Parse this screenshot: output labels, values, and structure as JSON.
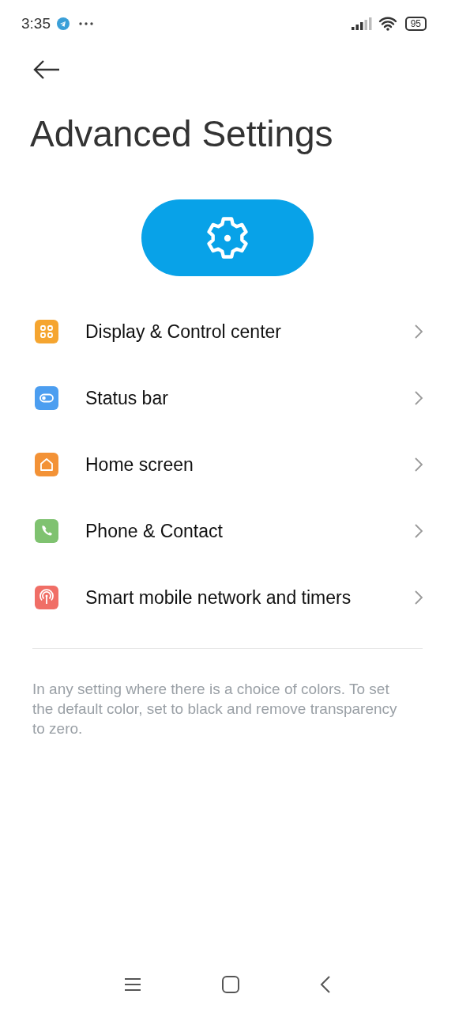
{
  "status_bar": {
    "time": "3:35",
    "battery": "95"
  },
  "title": "Advanced Settings",
  "items": [
    {
      "label": "Display & Control center",
      "kind": "grid",
      "color": "#f5a530"
    },
    {
      "label": "Status bar",
      "kind": "toggle",
      "color": "#4c9ef0"
    },
    {
      "label": "Home screen",
      "kind": "home",
      "color": "#f39236"
    },
    {
      "label": "Phone & Contact",
      "kind": "phone",
      "color": "#7fc270"
    },
    {
      "label": "Smart mobile network and timers",
      "kind": "antenna",
      "color": "#f06e66"
    }
  ],
  "note": "In any setting where there is a choice of colors. To set the default color, set to black and remove transparency to zero."
}
